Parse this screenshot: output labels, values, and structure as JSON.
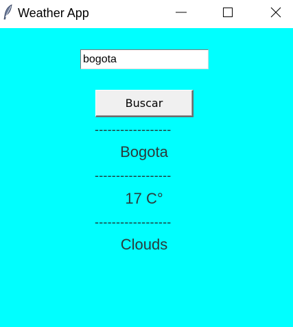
{
  "window": {
    "title": "Weather App",
    "icon": "feather-icon",
    "controls": [
      "minimize-icon",
      "maximize-icon",
      "close-icon"
    ]
  },
  "search": {
    "value": "bogota"
  },
  "button": {
    "label": "Buscar"
  },
  "separator": "------------------",
  "result": {
    "city": "Bogota",
    "temperature": "17  C°",
    "description": "Clouds"
  },
  "colors": {
    "background": "#00ffff",
    "titlebar": "#ffffff",
    "button": "#f0f0f0",
    "text": "#2b3a3a"
  }
}
